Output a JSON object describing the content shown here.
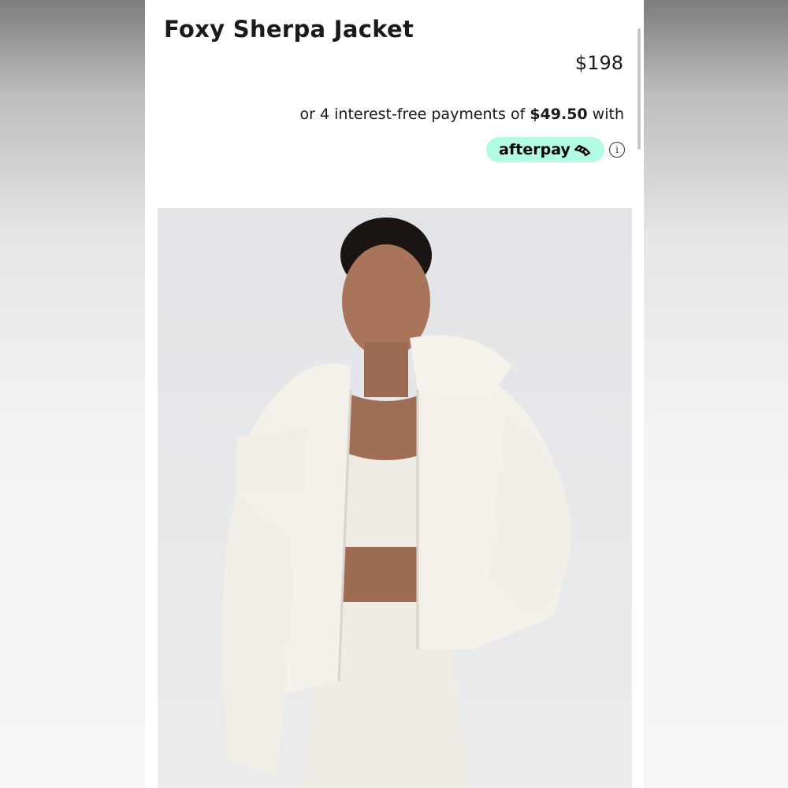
{
  "product": {
    "title": "Foxy Sherpa Jacket",
    "price": "$198",
    "installments_prefix": "or 4 interest-free payments of ",
    "installments_amount": "$49.50",
    "installments_suffix": " with"
  },
  "afterpay": {
    "label": "afterpay",
    "badge_color": "#b2fce4"
  },
  "icons": {
    "afterpay_logo": "afterpay-arrows-icon",
    "info": "info-icon",
    "info_glyph": "i"
  },
  "image": {
    "subject": "model wearing white sherpa jacket"
  }
}
